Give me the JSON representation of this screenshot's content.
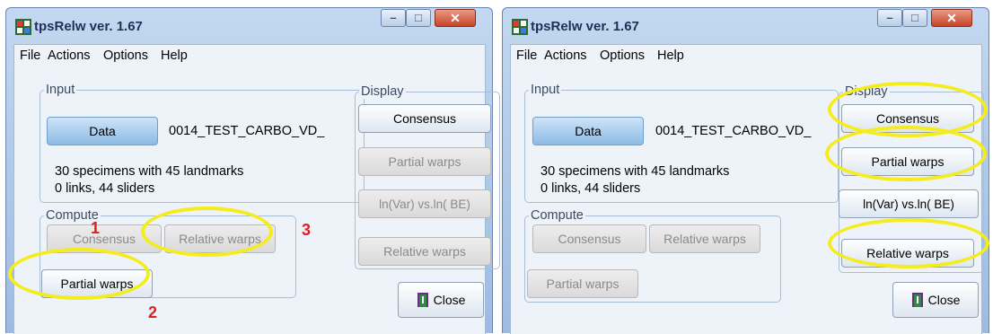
{
  "windows": [
    {
      "title": "tpsRelw ver. 1.67",
      "menu": [
        "File",
        "Actions",
        "Options",
        "Help"
      ],
      "input": {
        "legend": "Input",
        "data_button": "Data",
        "filename": "0014_TEST_CARBO_VD_",
        "specimens_text": "30 specimens with 45 landmarks",
        "links_text": "0 links, 44 sliders"
      },
      "compute": {
        "legend": "Compute",
        "consensus_button": "Consensus",
        "relative_warps_button": "Relative warps",
        "partial_warps_button": "Partial warps"
      },
      "display": {
        "legend": "Display",
        "consensus_button": "Consensus",
        "partial_warps_button": "Partial warps",
        "lnvar_button": "ln(Var) vs.ln( BE)",
        "relative_warps_button": "Relative warps"
      },
      "close_button": "Close",
      "annotations": [
        "1",
        "2",
        "3"
      ]
    },
    {
      "title": "tpsRelw ver. 1.67",
      "menu": [
        "File",
        "Actions",
        "Options",
        "Help"
      ],
      "input": {
        "legend": "Input",
        "data_button": "Data",
        "filename": "0014_TEST_CARBO_VD_",
        "specimens_text": "30 specimens with 45 landmarks",
        "links_text": "0 links, 44 sliders"
      },
      "compute": {
        "legend": "Compute",
        "consensus_button": "Consensus",
        "relative_warps_button": "Relative warps",
        "partial_warps_button": "Partial warps"
      },
      "display": {
        "legend": "Display",
        "consensus_button": "Consensus",
        "partial_warps_button": "Partial warps",
        "lnvar_button": "ln(Var) vs.ln( BE)",
        "relative_warps_button": "Relative warps"
      },
      "close_button": "Close"
    }
  ],
  "colors": {
    "highlight_ellipse": "#f4ec1c",
    "annotation_text": "#e21d1d",
    "title_text": "#1d2f5a",
    "window_frame": "#9dbbe2"
  }
}
